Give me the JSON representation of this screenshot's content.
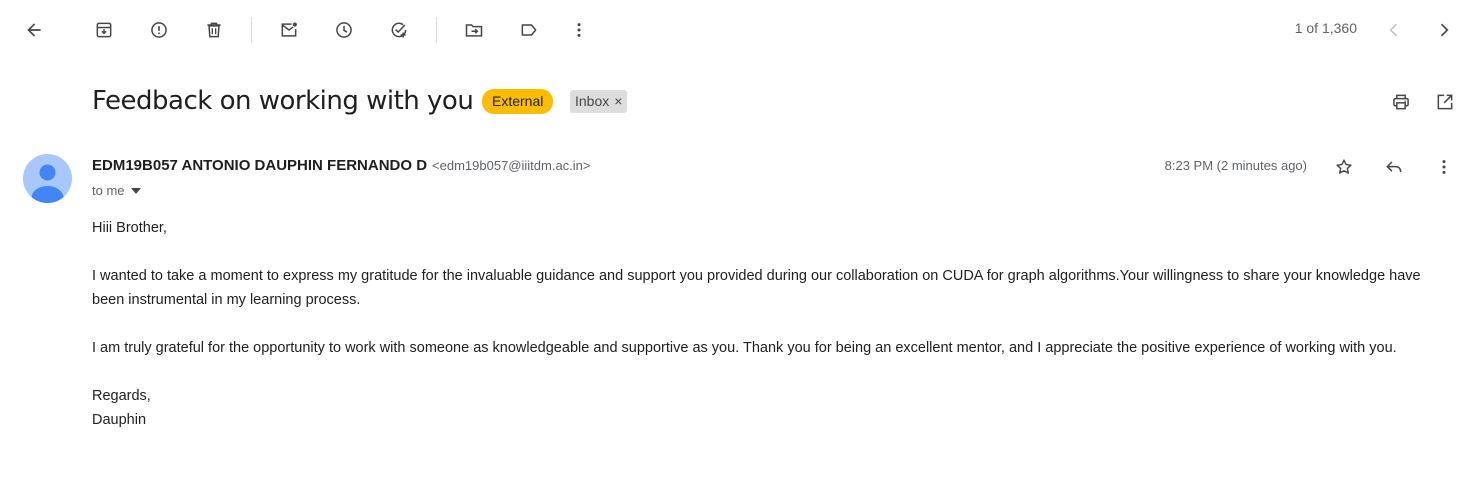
{
  "toolbar": {
    "back_icon": "arrow-left-icon",
    "archive_icon": "archive-icon",
    "report_spam_icon": "report-spam-icon",
    "delete_icon": "trash-icon",
    "mark_unread_icon": "mark-unread-icon",
    "snooze_icon": "clock-icon",
    "add_task_icon": "add-task-icon",
    "move_icon": "move-to-folder-icon",
    "label_icon": "label-icon",
    "more_icon": "more-vertical-icon",
    "counter": "1 of 1,360",
    "prev_icon": "chevron-left-icon",
    "next_icon": "chevron-right-icon"
  },
  "subject": {
    "title": "Feedback on working with you",
    "labels": [
      {
        "text": "External",
        "color": "#fbbc04"
      },
      {
        "text": "Inbox",
        "remove": "×",
        "color": "#dddddd"
      }
    ],
    "print_icon": "print-icon",
    "open_new_window_icon": "open-in-new-icon"
  },
  "message": {
    "sender_name": "EDM19B057 ANTONIO DAUPHIN FERNANDO D",
    "sender_email": "<edm19b057@iiitdm.ac.in>",
    "recipient": "to me",
    "time": "8:23 PM (2 minutes ago)",
    "avatar_color": "#a8c7fa",
    "body": [
      "Hiii Brother,",
      "I wanted to take a moment to express my gratitude for the invaluable guidance and support you provided during our collaboration on CUDA for graph algorithms.Your willingness to share your knowledge have been instrumental in my learning process.",
      "I am truly grateful for the opportunity to work with someone as knowledgeable and supportive as you. Thank you for being an excellent mentor, and I appreciate the positive experience of working with you.",
      "Regards,",
      "Dauphin"
    ]
  },
  "colors": {
    "icon": "#444746",
    "muted_text": "#5f6368",
    "external_label": "#fbbc04",
    "avatar": "#a8c7fa",
    "avatar_figure": "#4285f4"
  }
}
